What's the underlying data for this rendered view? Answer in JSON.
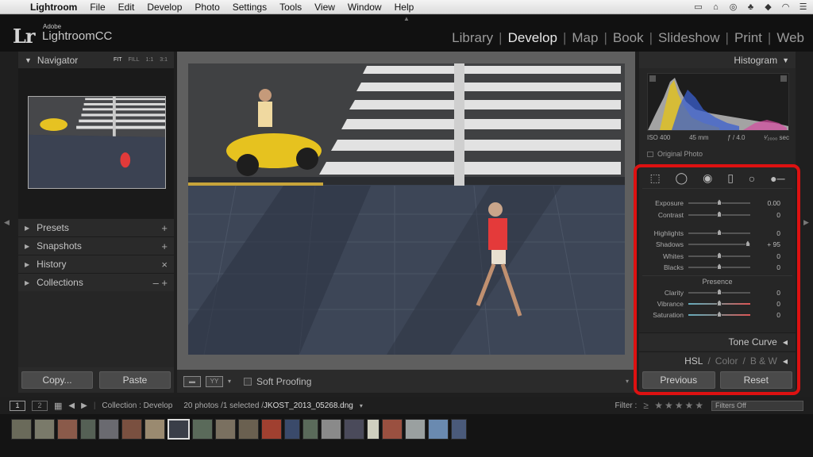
{
  "menubar": {
    "items": [
      "Lightroom",
      "File",
      "Edit",
      "Develop",
      "Photo",
      "Settings",
      "Tools",
      "View",
      "Window",
      "Help"
    ]
  },
  "identity": {
    "logo": "Lr",
    "adobe": "Adobe",
    "name": "LightroomCC"
  },
  "modules": [
    "Library",
    "Develop",
    "Map",
    "Book",
    "Slideshow",
    "Print",
    "Web"
  ],
  "active_module": "Develop",
  "navigator": {
    "title": "Navigator",
    "zooms": [
      "FIT",
      "FILL",
      "1:1",
      "3:1"
    ]
  },
  "left_panels": [
    {
      "label": "Presets",
      "ctl": "+"
    },
    {
      "label": "Snapshots",
      "ctl": "+"
    },
    {
      "label": "History",
      "ctl": "×"
    },
    {
      "label": "Collections",
      "ctl": "– +"
    }
  ],
  "left_buttons": {
    "copy": "Copy...",
    "paste": "Paste"
  },
  "toolbar": {
    "soft_proofing": "Soft Proofing"
  },
  "histogram": {
    "title": "Histogram",
    "iso": "ISO 400",
    "focal": "45 mm",
    "aperture": "ƒ / 4.0",
    "shutter": "¹⁄₂₀₀₀ sec",
    "original_photo": "Original Photo"
  },
  "basic_sliders": [
    {
      "label": "Exposure",
      "value": "0.00",
      "pos": 0.5
    },
    {
      "label": "Contrast",
      "value": "0",
      "pos": 0.5
    },
    {
      "label": "Highlights",
      "value": "0",
      "pos": 0.5
    },
    {
      "label": "Shadows",
      "value": "+ 95",
      "pos": 0.96
    },
    {
      "label": "Whites",
      "value": "0",
      "pos": 0.5
    },
    {
      "label": "Blacks",
      "value": "0",
      "pos": 0.5
    }
  ],
  "presence": {
    "title": "Presence",
    "sliders": [
      {
        "label": "Clarity",
        "value": "0",
        "pos": 0.5
      },
      {
        "label": "Vibrance",
        "value": "0",
        "pos": 0.5
      },
      {
        "label": "Saturation",
        "value": "0",
        "pos": 0.5
      }
    ]
  },
  "right_panels": {
    "tone_curve": "Tone Curve",
    "hsl": "HSL",
    "color": "Color",
    "bw": "B & W"
  },
  "right_buttons": {
    "previous": "Previous",
    "reset": "Reset"
  },
  "filmstrip": {
    "collection": "Collection : Develop",
    "photos": "20 photos /1 selected /",
    "filename": "JKOST_2013_05268.dng",
    "filter_label": "Filter :",
    "filters_off": "Filters Off"
  },
  "colors": {
    "accent_red": "#dd1111",
    "panel": "#262626",
    "center": "#5f5f5f"
  }
}
